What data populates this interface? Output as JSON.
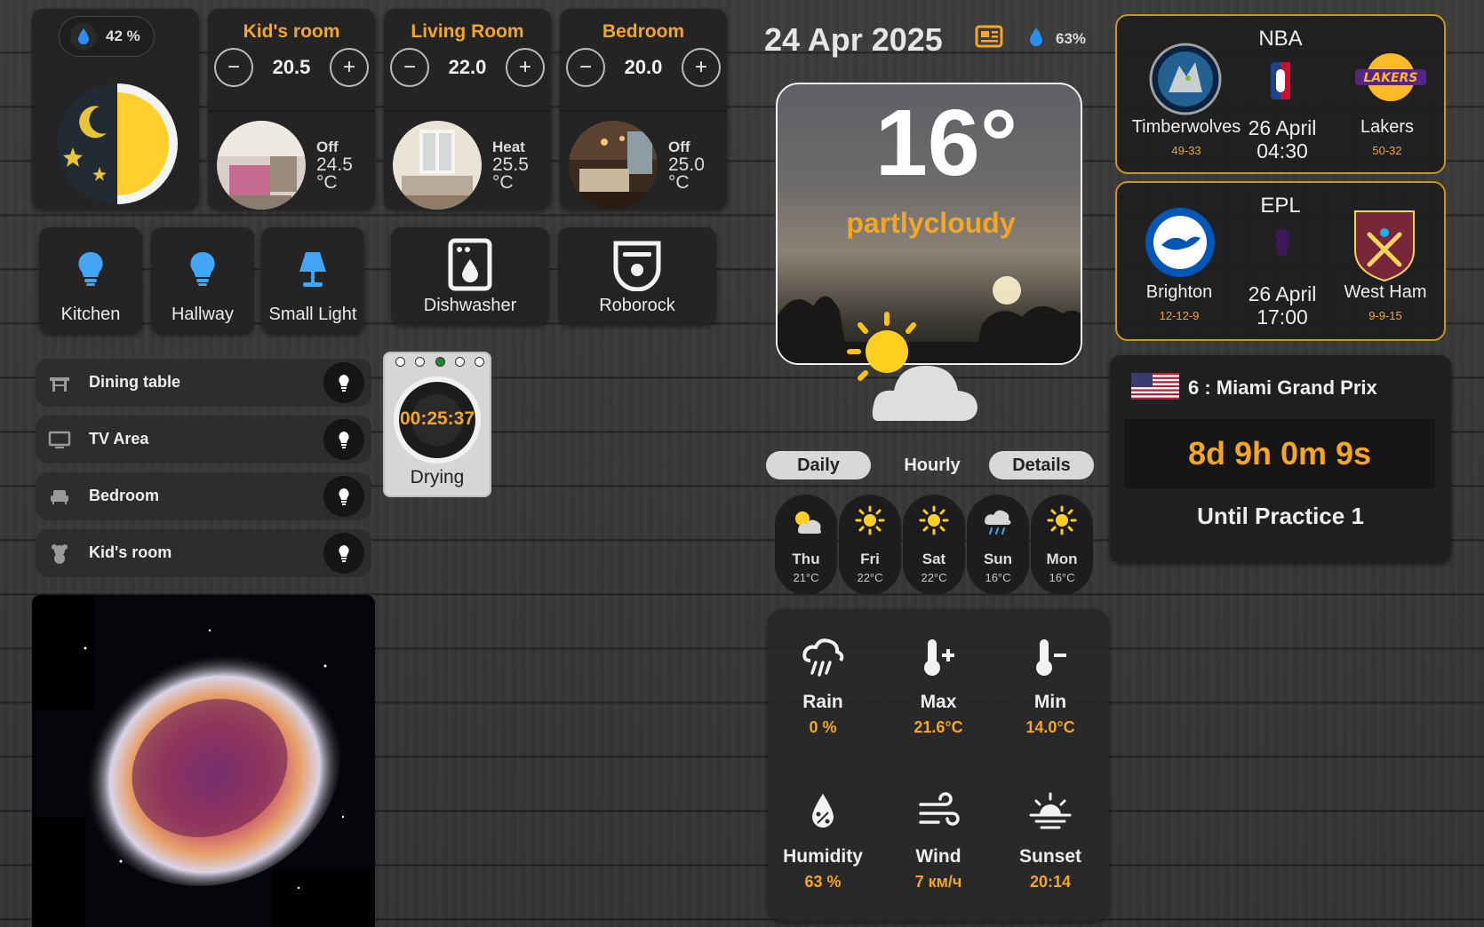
{
  "humidity": {
    "value": "42 %"
  },
  "rooms": [
    {
      "name": "Kid's room",
      "setpoint": "20.5",
      "mode": "Off",
      "current": "24.5",
      "unit": "°C"
    },
    {
      "name": "Living Room",
      "setpoint": "22.0",
      "mode": "Heat",
      "current": "25.5",
      "unit": "°C"
    },
    {
      "name": "Bedroom",
      "setpoint": "20.0",
      "mode": "Off",
      "current": "25.0",
      "unit": "°C"
    }
  ],
  "stepper": {
    "minus": "−",
    "plus": "+"
  },
  "lights": [
    {
      "label": "Kitchen",
      "icon": "bulb-icon"
    },
    {
      "label": "Hallway",
      "icon": "bulb-icon"
    },
    {
      "label": "Small Light",
      "icon": "lamp-icon"
    }
  ],
  "appliances": [
    {
      "label": "Dishwasher",
      "icon": "dishwasher-icon"
    },
    {
      "label": "Roborock",
      "icon": "robot-vacuum-icon"
    }
  ],
  "areas": [
    {
      "label": "Dining table",
      "icon": "dining-table-icon"
    },
    {
      "label": "TV Area",
      "icon": "tv-icon"
    },
    {
      "label": "Bedroom",
      "icon": "sofa-icon"
    },
    {
      "label": "Kid's room",
      "icon": "teddy-bear-icon"
    }
  ],
  "dryer": {
    "time": "00:25:37",
    "status": "Drying"
  },
  "weather": {
    "date": "24 Apr 2025",
    "humidity_small": "63%",
    "temperature": "16°",
    "condition": "partlycloudy",
    "tabs": [
      "Daily",
      "Hourly",
      "Details"
    ],
    "forecast": [
      {
        "day": "Thu",
        "temp": "21°C",
        "icon": "partly-cloudy-icon"
      },
      {
        "day": "Fri",
        "temp": "22°C",
        "icon": "sun-icon"
      },
      {
        "day": "Sat",
        "temp": "22°C",
        "icon": "sun-icon"
      },
      {
        "day": "Sun",
        "temp": "16°C",
        "icon": "rain-cloud-icon"
      },
      {
        "day": "Mon",
        "temp": "16°C",
        "icon": "sun-icon"
      }
    ],
    "details": [
      {
        "label": "Rain",
        "value": "0 %",
        "icon": "rain-icon"
      },
      {
        "label": "Max",
        "value": "21.6°C",
        "icon": "thermometer-plus-icon"
      },
      {
        "label": "Min",
        "value": "14.0°C",
        "icon": "thermometer-minus-icon"
      },
      {
        "label": "Humidity",
        "value": "63 %",
        "icon": "humidity-icon"
      },
      {
        "label": "Wind",
        "value": "7 км/ч",
        "icon": "wind-icon"
      },
      {
        "label": "Sunset",
        "value": "20:14",
        "icon": "sunset-icon"
      }
    ]
  },
  "nba": {
    "league": "NBA",
    "home": {
      "name": "Timberwolves",
      "record": "49-33"
    },
    "away": {
      "name": "Lakers",
      "record": "50-32"
    },
    "date": "26 April",
    "time": "04:30"
  },
  "epl": {
    "league": "EPL",
    "home": {
      "name": "Brighton",
      "record": "12-12-9"
    },
    "away": {
      "name": "West Ham",
      "record": "9-9-15"
    },
    "date": "26 April",
    "time": "17:00"
  },
  "f1": {
    "race": "6 : Miami Grand Prix",
    "countdown": "8d 9h 0m 9s",
    "until": "Until Practice 1"
  },
  "colors": {
    "accent": "#f5a623",
    "card": "#222222",
    "gold_border": "#c8951e"
  }
}
